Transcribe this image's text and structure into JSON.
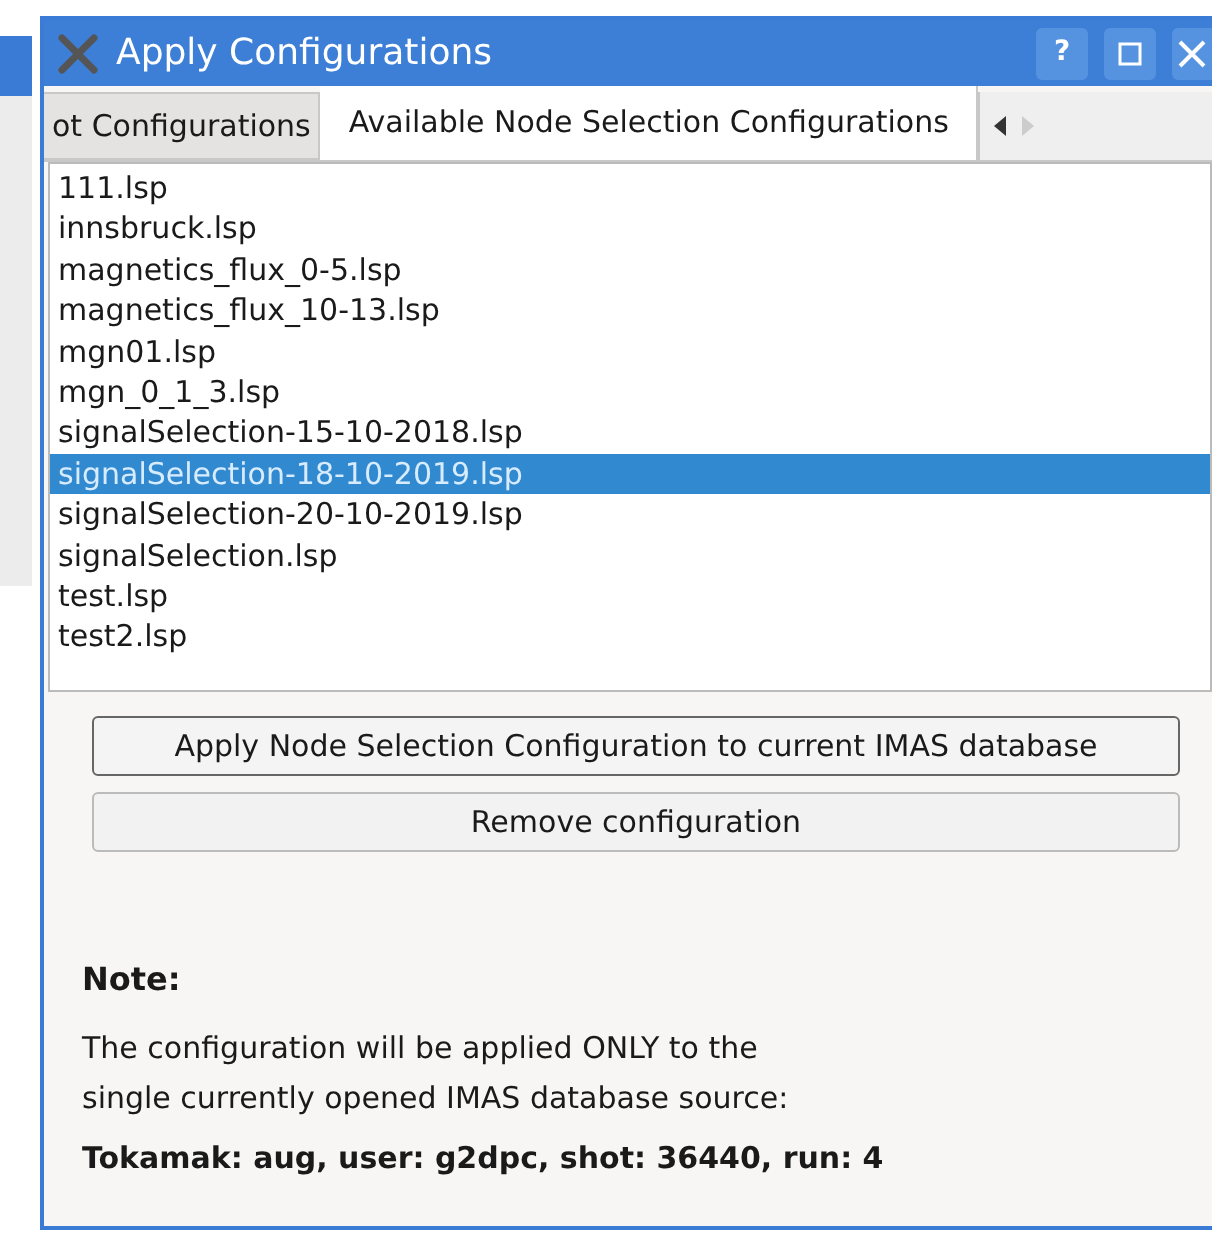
{
  "window": {
    "title": "Apply Configurations",
    "help_button": "?"
  },
  "tabs": [
    {
      "label": "ot Configurations",
      "selected": false
    },
    {
      "label": "Available Node Selection Configurations",
      "selected": true
    }
  ],
  "files": [
    {
      "name": "111.lsp",
      "selected": false
    },
    {
      "name": "innsbruck.lsp",
      "selected": false
    },
    {
      "name": "magnetics_flux_0-5.lsp",
      "selected": false
    },
    {
      "name": "magnetics_flux_10-13.lsp",
      "selected": false
    },
    {
      "name": "mgn01.lsp",
      "selected": false
    },
    {
      "name": "mgn_0_1_3.lsp",
      "selected": false
    },
    {
      "name": "signalSelection-15-10-2018.lsp",
      "selected": false
    },
    {
      "name": "signalSelection-18-10-2019.lsp",
      "selected": true
    },
    {
      "name": "signalSelection-20-10-2019.lsp",
      "selected": false
    },
    {
      "name": "signalSelection.lsp",
      "selected": false
    },
    {
      "name": "test.lsp",
      "selected": false
    },
    {
      "name": "test2.lsp",
      "selected": false
    }
  ],
  "buttons": [
    "Apply Node Selection Configuration to current IMAS database",
    "Remove configuration"
  ],
  "note": {
    "title": "Note:",
    "lines": [
      "The configuration will be applied ONLY to the",
      "single currently opened IMAS database source:"
    ],
    "source": "Tokamak: aug, user: g2dpc, shot: 36440, run: 4"
  }
}
